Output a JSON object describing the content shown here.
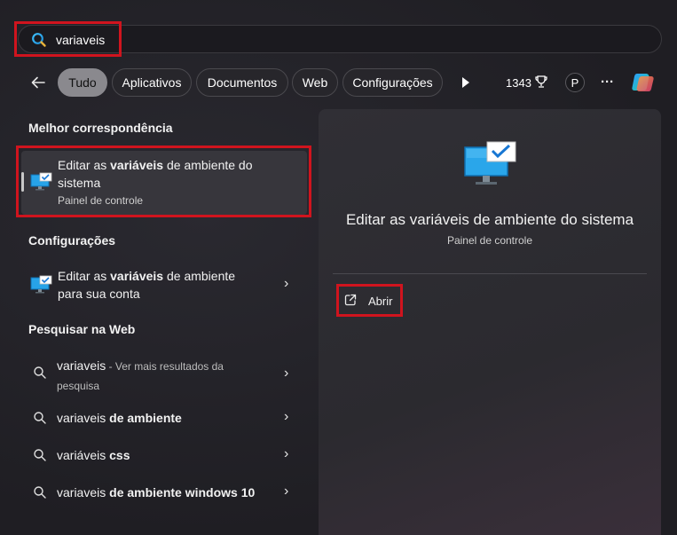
{
  "search": {
    "value": "variaveis"
  },
  "nav": {
    "back_icon": "arrow-left-icon",
    "tabs": [
      "Tudo",
      "Aplicativos",
      "Documentos",
      "Web",
      "Configurações"
    ],
    "points": "1343",
    "avatar": "P",
    "more": "···"
  },
  "best_match": {
    "header": "Melhor correspondência",
    "title_pre": "Editar as ",
    "title_bold": "variáveis",
    "title_post": " de ambiente do",
    "title_line2": "sistema",
    "subtitle": "Painel de controle"
  },
  "settings": {
    "header": "Configurações",
    "title_pre": "Editar as ",
    "title_bold": "variáveis",
    "title_post": " de ambiente",
    "title_line2": "para sua conta"
  },
  "web": {
    "header": "Pesquisar na Web",
    "first_pre": "variaveis",
    "first_suffix": " - Ver mais resultados da",
    "first_line2": "pesquisa",
    "items": [
      {
        "pre": "variaveis",
        "bold": " de ambiente"
      },
      {
        "pre": "variáveis",
        "bold": " css"
      },
      {
        "pre": "variaveis",
        "bold": " de ambiente windows 10"
      }
    ]
  },
  "detail": {
    "title": "Editar as variáveis de ambiente do sistema",
    "subtitle": "Painel de controle",
    "open_label": "Abrir"
  },
  "colors": {
    "highlight": "#d0141e",
    "accent": "#3aa0f0"
  }
}
